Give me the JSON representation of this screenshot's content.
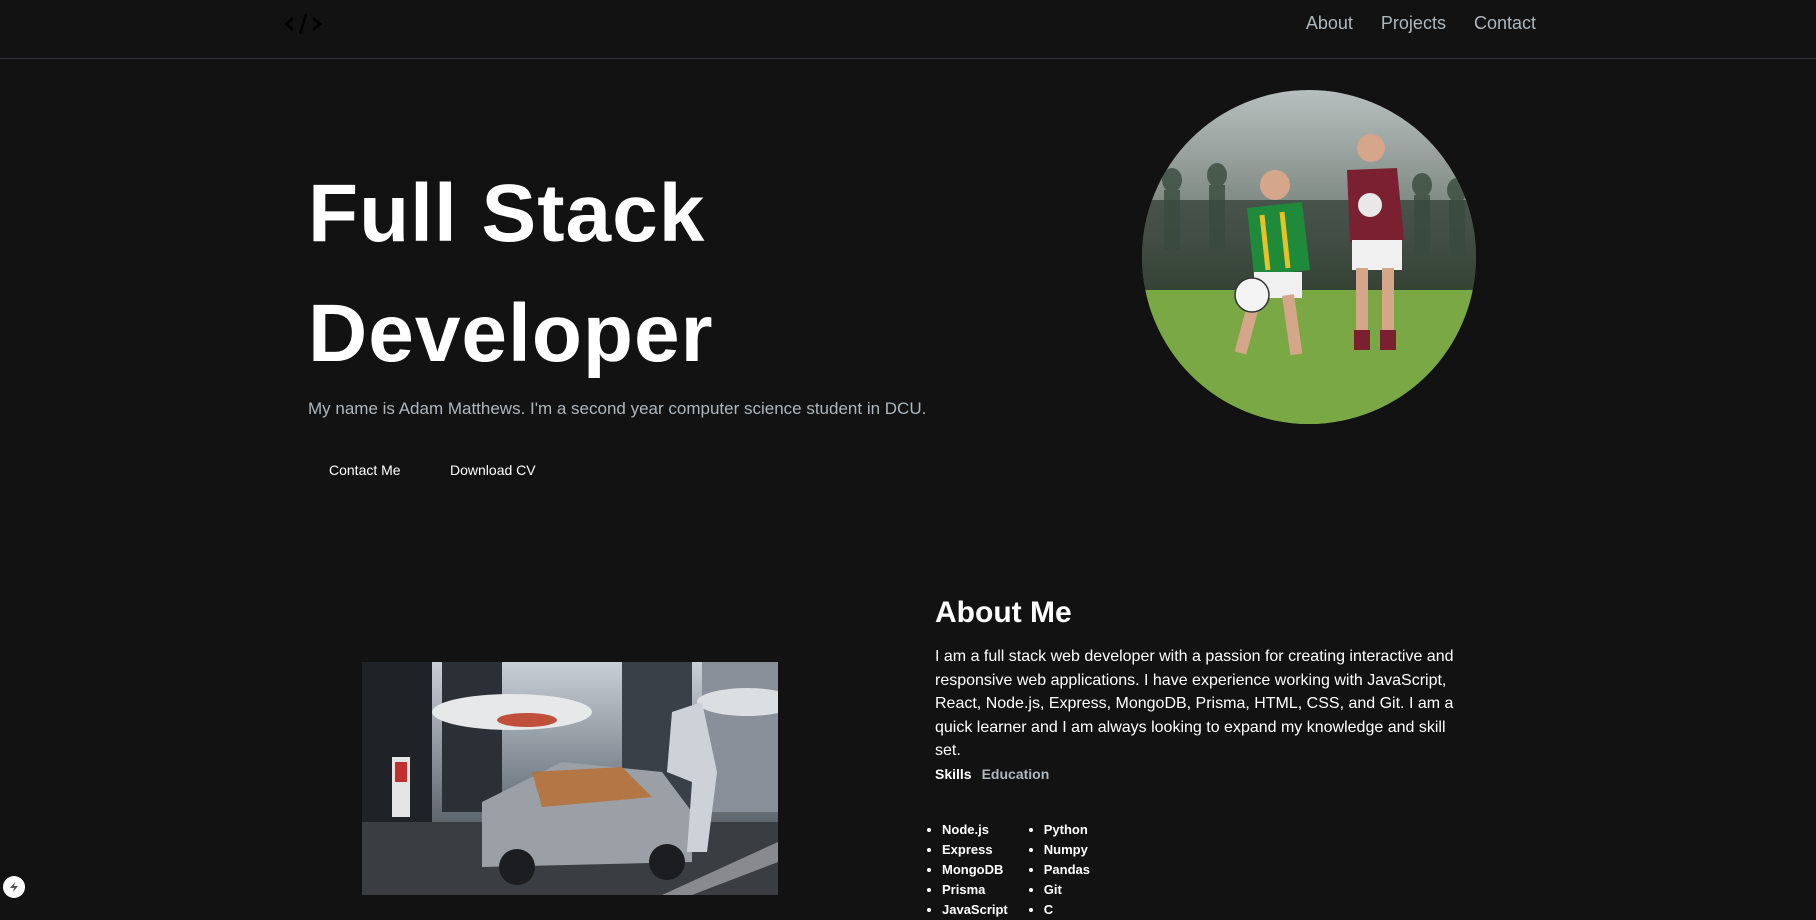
{
  "nav": {
    "logo_icon": "code-icon",
    "links": [
      "About",
      "Projects",
      "Contact"
    ]
  },
  "hero": {
    "title_line1": "Full Stack",
    "title_line2": "Developer",
    "subtitle": "My name is Adam Matthews. I'm a second year computer science student in DCU.",
    "buttons": {
      "contact": "Contact Me",
      "cv": "Download CV"
    },
    "photo_icon": "profile-photo"
  },
  "about": {
    "title": "About Me",
    "text": "I am a full stack web developer with a passion for creating interactive and responsive web applications. I have experience working with JavaScript, React, Node.js, Express, MongoDB, Prisma, HTML, CSS, and Git. I am a quick learner and I am always looking to expand my knowledge and skill set.",
    "tabs": [
      "Skills",
      "Education"
    ],
    "skills_col1": [
      "Node.js",
      "Express",
      "MongoDB",
      "Prisma",
      "JavaScript"
    ],
    "skills_col2": [
      "Python",
      "Numpy",
      "Pandas",
      "Git",
      "C"
    ]
  },
  "colors": {
    "background": "#121212",
    "muted_text": "#adb7be",
    "border": "#33353f"
  }
}
